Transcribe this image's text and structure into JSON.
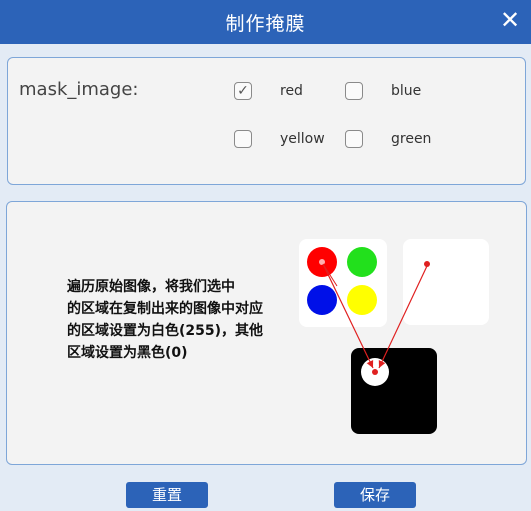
{
  "window": {
    "title": "制作掩膜",
    "close_glyph": "✕"
  },
  "mask": {
    "label": "mask_image:",
    "options": [
      {
        "label": "red",
        "checked": true
      },
      {
        "label": "blue",
        "checked": false
      },
      {
        "label": "yellow",
        "checked": false
      },
      {
        "label": "green",
        "checked": false
      }
    ],
    "check_glyph": "✓"
  },
  "description": [
    "遍历原始图像，将我们选中",
    "的区域在复制出来的图像中对应",
    "的区域设置为白色(255)，其他",
    "区域设置为黑色(0)"
  ],
  "diagram_colors": {
    "dot_red": "#ff0000",
    "dot_green": "#22e01c",
    "dot_blue": "#0010e8",
    "dot_yellow": "#ffff00",
    "arrow": "#e02020",
    "mask_bg": "#000000",
    "mask_spot": "#ffffff"
  },
  "buttons": {
    "reset": "重置",
    "save": "保存"
  },
  "colors": {
    "accent": "#2c63b8",
    "panel_border": "#7ea6d8"
  }
}
